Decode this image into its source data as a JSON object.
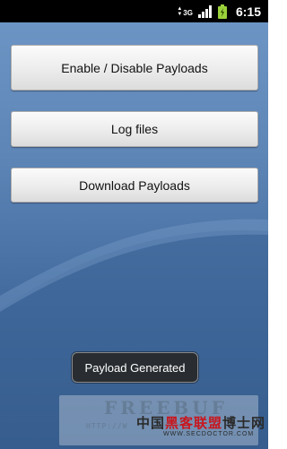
{
  "status_bar": {
    "network": "3G",
    "time": "6:15"
  },
  "buttons": {
    "enable_disable": "Enable / Disable Payloads",
    "log_files": "Log files",
    "download": "Download Payloads"
  },
  "toast": {
    "message": "Payload Generated"
  },
  "watermark": {
    "logo": "FREEBUF",
    "url": "HTTP://W",
    "cn_part1": "中国",
    "cn_part2": "黑客联盟",
    "cn_part3": "博士网",
    "site": "WWW.SECDOCTOR.COM"
  },
  "colors": {
    "background_top": "#6f97c6",
    "background_bottom": "#2f5584",
    "status_bar": "#000000",
    "button_face": "#ececec",
    "toast_bg": "#282828"
  }
}
